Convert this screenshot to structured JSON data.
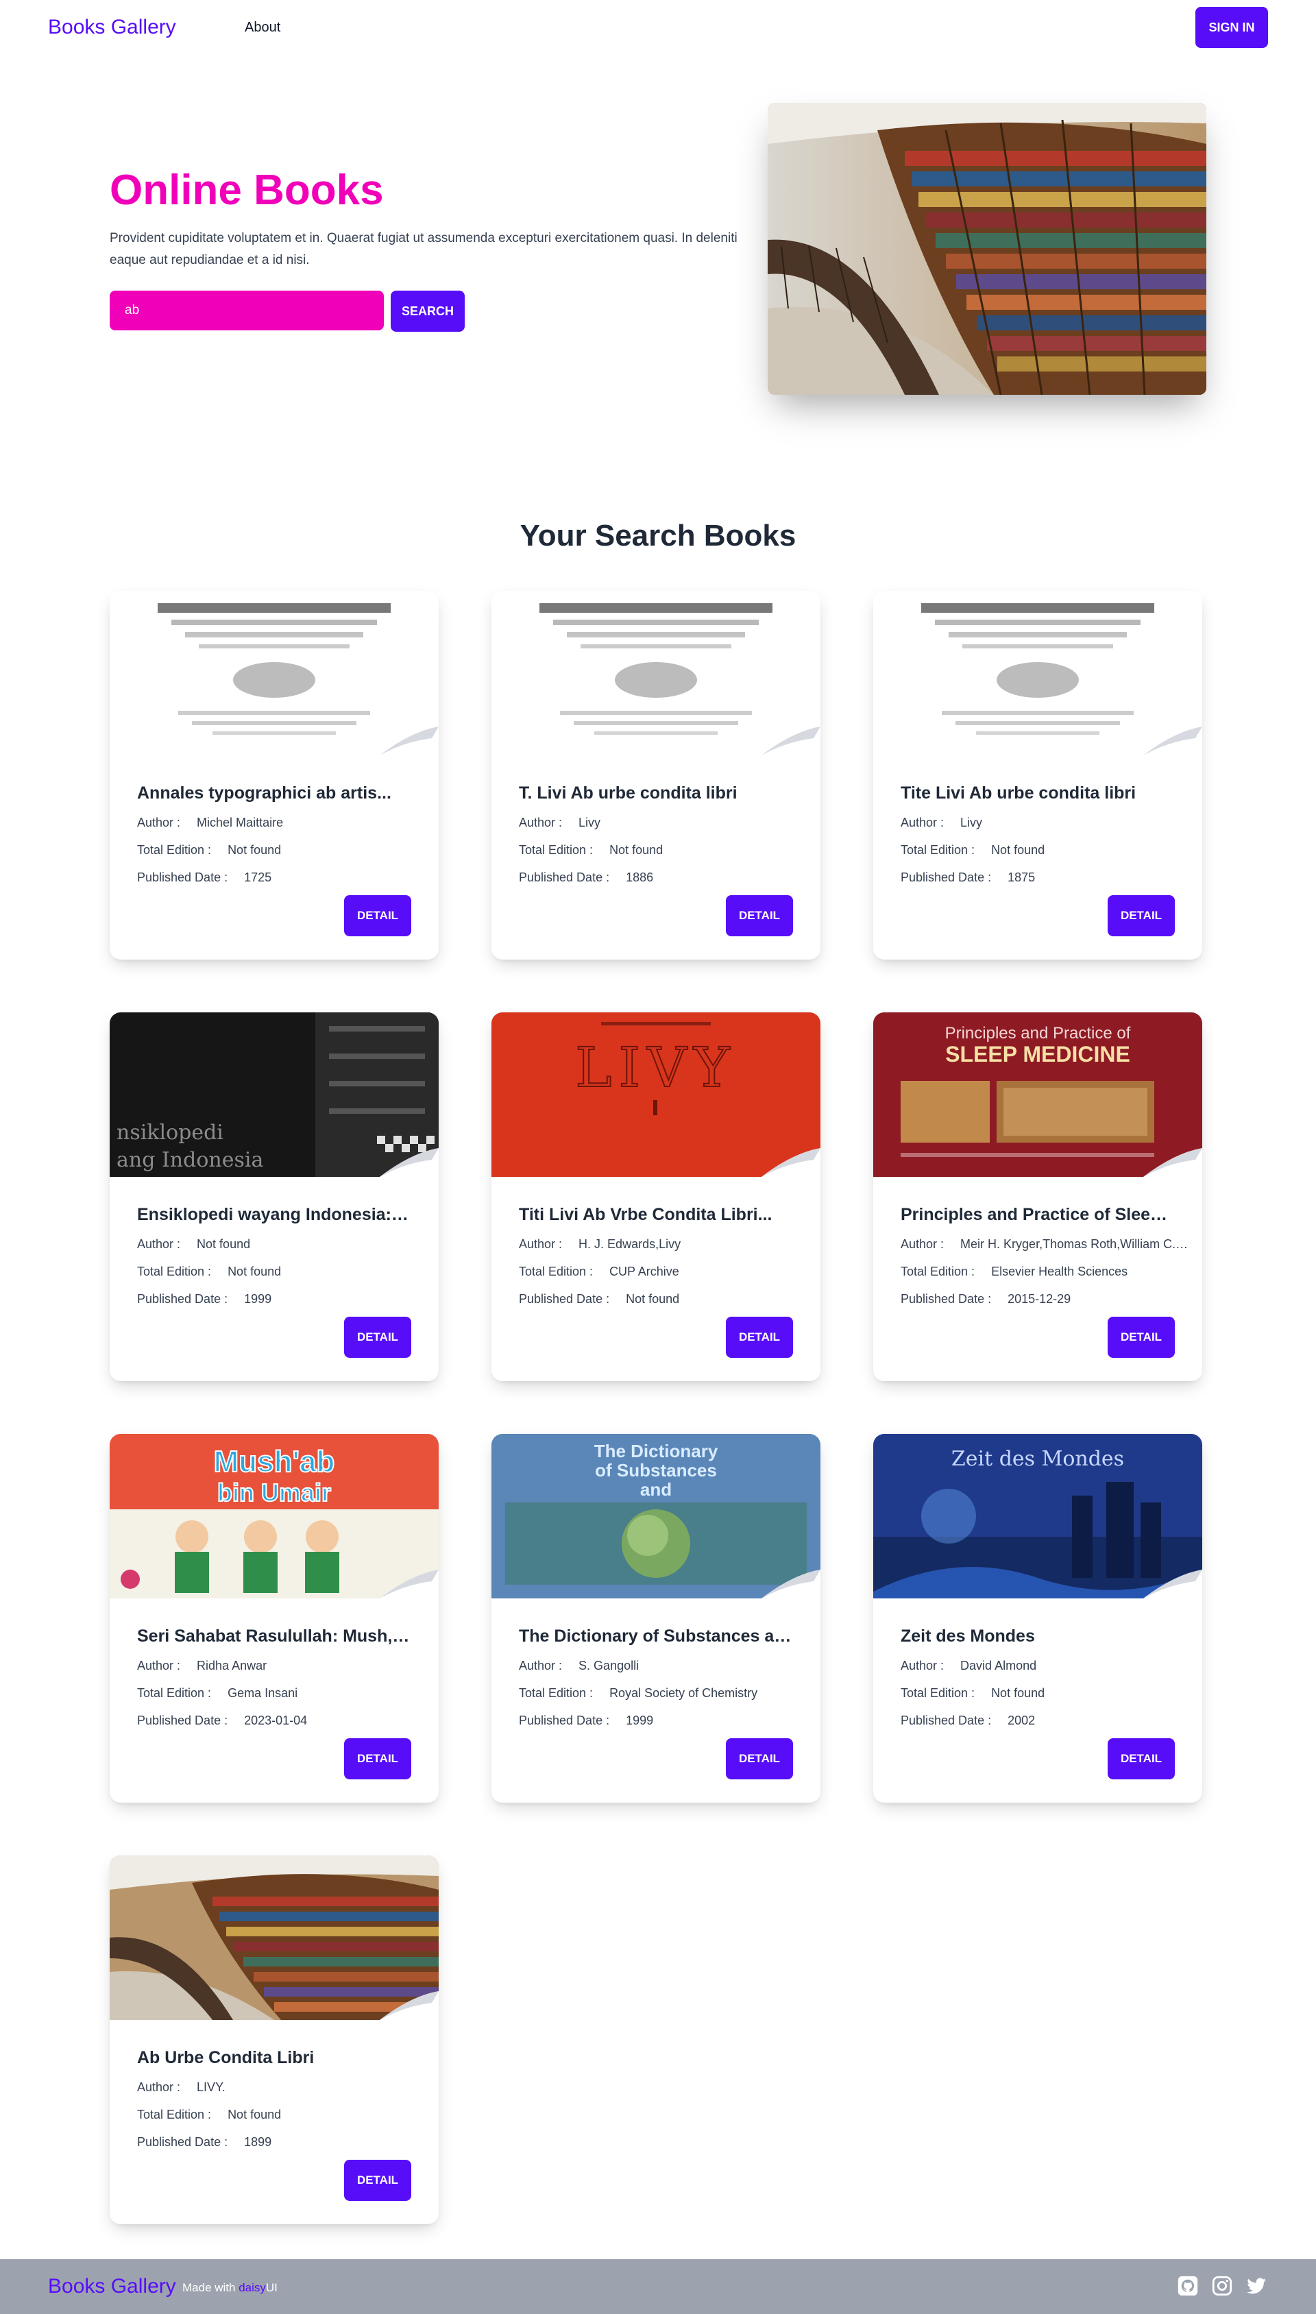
{
  "navbar": {
    "brand": "Books Gallery",
    "about": "About",
    "signin": "SIGN IN"
  },
  "hero": {
    "title": "Online Books",
    "description": "Provident cupiditate voluptatem et in. Quaerat fugiat ut assumenda excepturi exercitationem quasi. In deleniti eaque aut repudiandae et a id nisi.",
    "search_value": "ab",
    "search_button": "SEARCH"
  },
  "section": {
    "title": "Your Search Books"
  },
  "labels": {
    "author": "Author :",
    "edition": "Total Edition :",
    "date": "Published Date :",
    "detail": "DETAIL"
  },
  "books": [
    {
      "title": "Annales typographici ab artis...",
      "author": "Michel Maittaire",
      "edition": "Not found",
      "date": "1725",
      "cover": "Annales typographici title page",
      "cover_kind": "paper"
    },
    {
      "title": "T. Livi Ab urbe condita libri",
      "author": "Livy",
      "edition": "Not found",
      "date": "1886",
      "cover": "AB VRBE CONDITA title page",
      "cover_kind": "paper"
    },
    {
      "title": "Tite Livi Ab urbe condita libri",
      "author": "Livy",
      "edition": "Not found",
      "date": "1875",
      "cover": "AB URBE CONDITA title page",
      "cover_kind": "paper"
    },
    {
      "title": "Ensiklopedi wayang Indonesia: A-B",
      "author": "Not found",
      "edition": "Not found",
      "date": "1999",
      "cover": "dark cover Ensiklopedi wayang Indonesia",
      "cover_kind": "dark"
    },
    {
      "title": "Titi Livi Ab Vrbe Condita Libri...",
      "author": "H. J. Edwards,Livy",
      "edition": "CUP Archive",
      "date": "Not found",
      "cover": "red cover LIVY I",
      "cover_kind": "red"
    },
    {
      "title": "Principles and Practice of Sleep...",
      "author": "Meir H. Kryger,Thomas Roth,William C. Dement",
      "edition": "Elsevier Health Sciences",
      "date": "2015-12-29",
      "cover": "maroon cover Sleep Medicine",
      "cover_kind": "maroon"
    },
    {
      "title": "Seri Sahabat Rasulullah: Mush,ab...",
      "author": "Ridha Anwar",
      "edition": "Gema Insani",
      "date": "2023-01-04",
      "cover": "illustrated children cover Mush'ab bin Umair",
      "cover_kind": "kids"
    },
    {
      "title": "The Dictionary of Substances and...",
      "author": "S. Gangolli",
      "edition": "Royal Society of Chemistry",
      "date": "1999",
      "cover": "blue cover Dictionary of Substances",
      "cover_kind": "blue"
    },
    {
      "title": "Zeit des Mondes",
      "author": "David Almond",
      "edition": "Not found",
      "date": "2002",
      "cover": "night castle cover Zeit des Mondes",
      "cover_kind": "night"
    },
    {
      "title": "Ab Urbe Condita Libri",
      "author": "LIVY.",
      "edition": "Not found",
      "date": "1899",
      "cover": "library bookshelf photo",
      "cover_kind": "library"
    }
  ],
  "footer": {
    "brand": "Books Gallery",
    "made_with": "Made with",
    "daisy": "daisy",
    "ui": "UI"
  },
  "colors": {
    "primary": "#570df8",
    "secondary": "#f000b8",
    "footer_bg": "#9ca3af"
  },
  "icons": [
    "github-icon",
    "instagram-icon",
    "twitter-icon"
  ]
}
